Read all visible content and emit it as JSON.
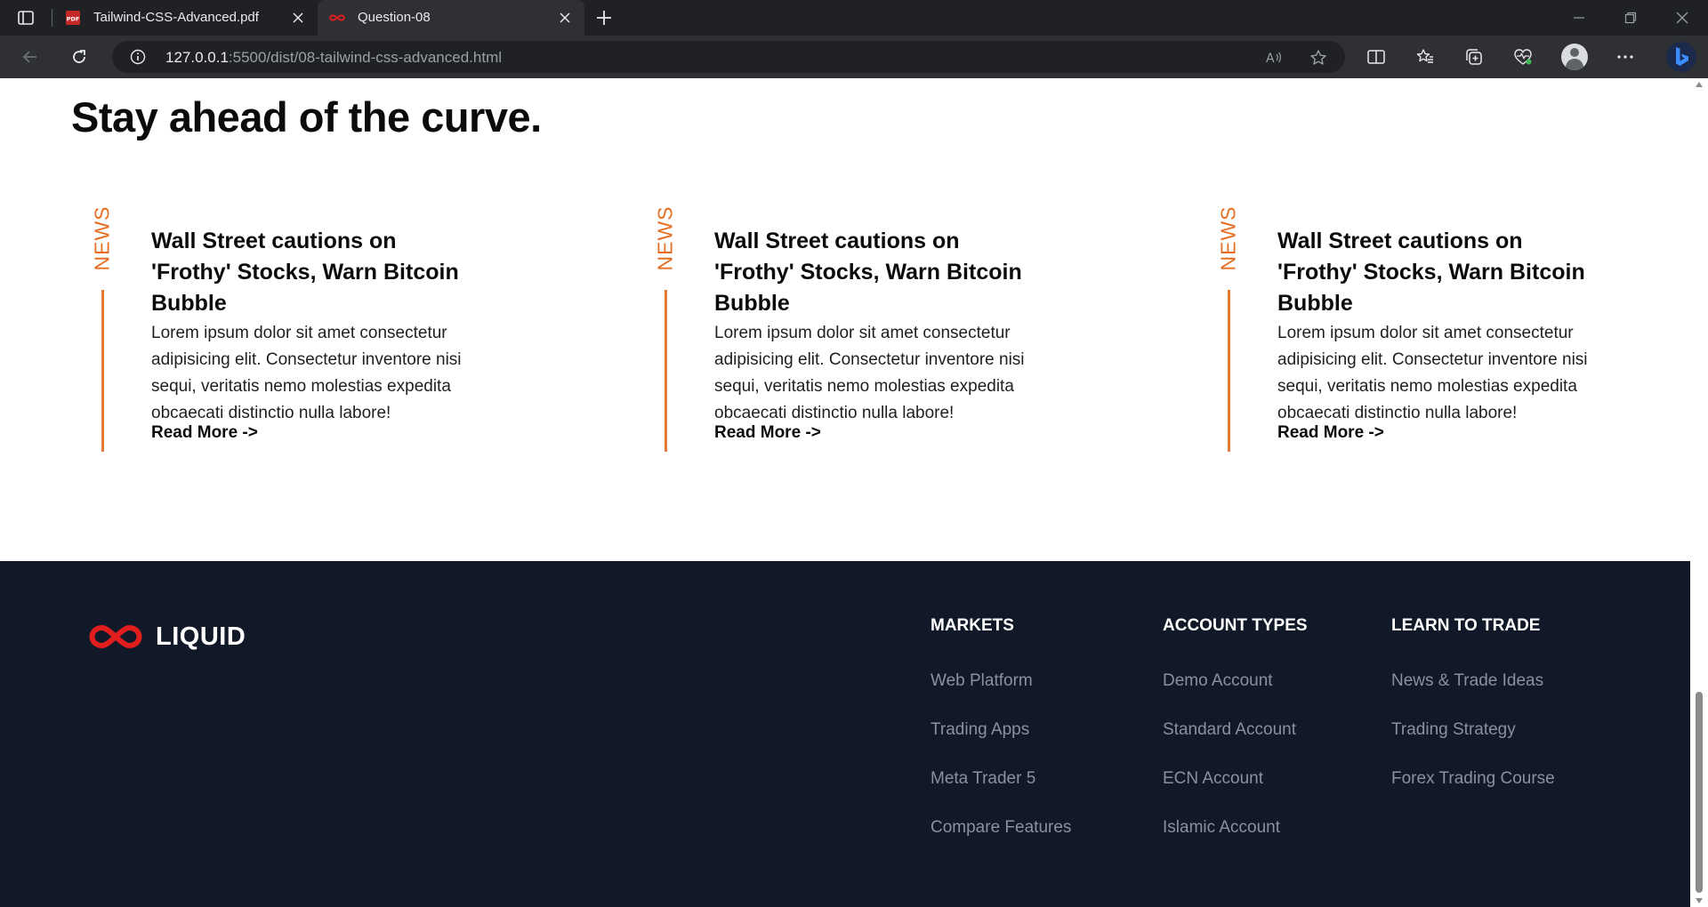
{
  "browser": {
    "tabs": [
      {
        "title": "Tailwind-CSS-Advanced.pdf",
        "icon": "pdf-icon",
        "active": false
      },
      {
        "title": "Question-08",
        "icon": "infinity-icon",
        "active": true
      }
    ],
    "address": {
      "host": "127.0.0.1",
      "rest": ":5500/dist/08-tailwind-css-advanced.html"
    }
  },
  "page": {
    "section_title": "Stay ahead of the curve.",
    "news": [
      {
        "tag": "NEWS",
        "title": "Wall Street cautions on 'Frothy' Stocks, Warn Bitcoin Bubble",
        "body": "Lorem ipsum dolor sit amet consectetur adipisicing elit. Consectetur inventore nisi sequi, veritatis nemo molestias expedita obcaecati distinctio nulla labore!",
        "link": "Read More ->"
      },
      {
        "tag": "NEWS",
        "title": "Wall Street cautions on 'Frothy' Stocks, Warn Bitcoin Bubble",
        "body": "Lorem ipsum dolor sit amet consectetur adipisicing elit. Consectetur inventore nisi sequi, veritatis nemo molestias expedita obcaecati distinctio nulla labore!",
        "link": "Read More ->"
      },
      {
        "tag": "NEWS",
        "title": "Wall Street cautions on 'Frothy' Stocks, Warn Bitcoin Bubble",
        "body": "Lorem ipsum dolor sit amet consectetur adipisicing elit. Consectetur inventore nisi sequi, veritatis nemo molestias expedita obcaecati distinctio nulla labore!",
        "link": "Read More ->"
      }
    ],
    "footer": {
      "logo_text": "LIQUID",
      "columns": [
        {
          "heading": "MARKETS",
          "links": [
            "Web Platform",
            "Trading Apps",
            "Meta Trader 5",
            "Compare Features"
          ]
        },
        {
          "heading": "ACCOUNT TYPES",
          "links": [
            "Demo Account",
            "Standard Account",
            "ECN Account",
            "Islamic Account"
          ]
        },
        {
          "heading": "LEARN TO TRADE",
          "links": [
            "News & Trade Ideas",
            "Trading Strategy",
            "Forex Trading Course"
          ]
        }
      ]
    }
  },
  "colors": {
    "accent": "#e76f24",
    "logo_red": "#e11d1d",
    "footer_bg": "#111827",
    "footer_link": "#8b919c"
  }
}
